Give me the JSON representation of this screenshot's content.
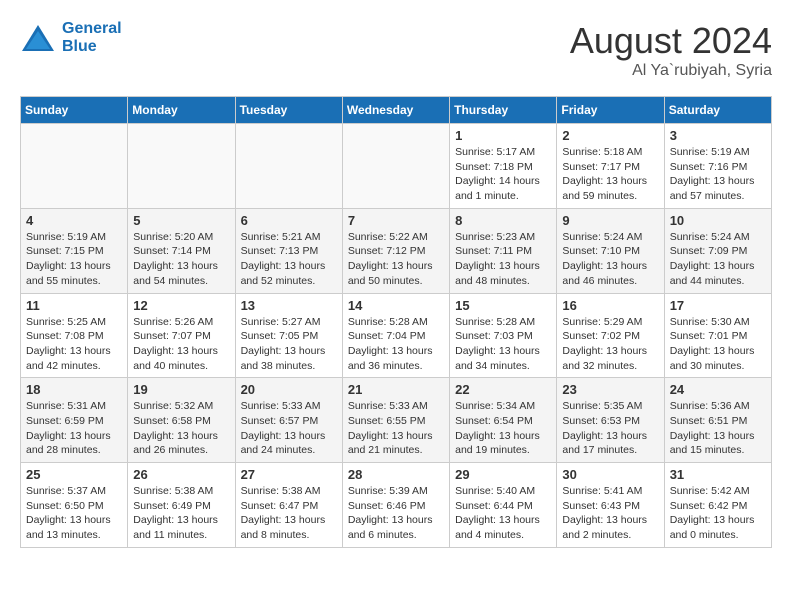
{
  "header": {
    "logo_line1": "General",
    "logo_line2": "Blue",
    "month": "August 2024",
    "location": "Al Ya`rubiyah, Syria"
  },
  "weekdays": [
    "Sunday",
    "Monday",
    "Tuesday",
    "Wednesday",
    "Thursday",
    "Friday",
    "Saturday"
  ],
  "weeks": [
    [
      {
        "day": "",
        "info": ""
      },
      {
        "day": "",
        "info": ""
      },
      {
        "day": "",
        "info": ""
      },
      {
        "day": "",
        "info": ""
      },
      {
        "day": "1",
        "info": "Sunrise: 5:17 AM\nSunset: 7:18 PM\nDaylight: 14 hours\nand 1 minute."
      },
      {
        "day": "2",
        "info": "Sunrise: 5:18 AM\nSunset: 7:17 PM\nDaylight: 13 hours\nand 59 minutes."
      },
      {
        "day": "3",
        "info": "Sunrise: 5:19 AM\nSunset: 7:16 PM\nDaylight: 13 hours\nand 57 minutes."
      }
    ],
    [
      {
        "day": "4",
        "info": "Sunrise: 5:19 AM\nSunset: 7:15 PM\nDaylight: 13 hours\nand 55 minutes."
      },
      {
        "day": "5",
        "info": "Sunrise: 5:20 AM\nSunset: 7:14 PM\nDaylight: 13 hours\nand 54 minutes."
      },
      {
        "day": "6",
        "info": "Sunrise: 5:21 AM\nSunset: 7:13 PM\nDaylight: 13 hours\nand 52 minutes."
      },
      {
        "day": "7",
        "info": "Sunrise: 5:22 AM\nSunset: 7:12 PM\nDaylight: 13 hours\nand 50 minutes."
      },
      {
        "day": "8",
        "info": "Sunrise: 5:23 AM\nSunset: 7:11 PM\nDaylight: 13 hours\nand 48 minutes."
      },
      {
        "day": "9",
        "info": "Sunrise: 5:24 AM\nSunset: 7:10 PM\nDaylight: 13 hours\nand 46 minutes."
      },
      {
        "day": "10",
        "info": "Sunrise: 5:24 AM\nSunset: 7:09 PM\nDaylight: 13 hours\nand 44 minutes."
      }
    ],
    [
      {
        "day": "11",
        "info": "Sunrise: 5:25 AM\nSunset: 7:08 PM\nDaylight: 13 hours\nand 42 minutes."
      },
      {
        "day": "12",
        "info": "Sunrise: 5:26 AM\nSunset: 7:07 PM\nDaylight: 13 hours\nand 40 minutes."
      },
      {
        "day": "13",
        "info": "Sunrise: 5:27 AM\nSunset: 7:05 PM\nDaylight: 13 hours\nand 38 minutes."
      },
      {
        "day": "14",
        "info": "Sunrise: 5:28 AM\nSunset: 7:04 PM\nDaylight: 13 hours\nand 36 minutes."
      },
      {
        "day": "15",
        "info": "Sunrise: 5:28 AM\nSunset: 7:03 PM\nDaylight: 13 hours\nand 34 minutes."
      },
      {
        "day": "16",
        "info": "Sunrise: 5:29 AM\nSunset: 7:02 PM\nDaylight: 13 hours\nand 32 minutes."
      },
      {
        "day": "17",
        "info": "Sunrise: 5:30 AM\nSunset: 7:01 PM\nDaylight: 13 hours\nand 30 minutes."
      }
    ],
    [
      {
        "day": "18",
        "info": "Sunrise: 5:31 AM\nSunset: 6:59 PM\nDaylight: 13 hours\nand 28 minutes."
      },
      {
        "day": "19",
        "info": "Sunrise: 5:32 AM\nSunset: 6:58 PM\nDaylight: 13 hours\nand 26 minutes."
      },
      {
        "day": "20",
        "info": "Sunrise: 5:33 AM\nSunset: 6:57 PM\nDaylight: 13 hours\nand 24 minutes."
      },
      {
        "day": "21",
        "info": "Sunrise: 5:33 AM\nSunset: 6:55 PM\nDaylight: 13 hours\nand 21 minutes."
      },
      {
        "day": "22",
        "info": "Sunrise: 5:34 AM\nSunset: 6:54 PM\nDaylight: 13 hours\nand 19 minutes."
      },
      {
        "day": "23",
        "info": "Sunrise: 5:35 AM\nSunset: 6:53 PM\nDaylight: 13 hours\nand 17 minutes."
      },
      {
        "day": "24",
        "info": "Sunrise: 5:36 AM\nSunset: 6:51 PM\nDaylight: 13 hours\nand 15 minutes."
      }
    ],
    [
      {
        "day": "25",
        "info": "Sunrise: 5:37 AM\nSunset: 6:50 PM\nDaylight: 13 hours\nand 13 minutes."
      },
      {
        "day": "26",
        "info": "Sunrise: 5:38 AM\nSunset: 6:49 PM\nDaylight: 13 hours\nand 11 minutes."
      },
      {
        "day": "27",
        "info": "Sunrise: 5:38 AM\nSunset: 6:47 PM\nDaylight: 13 hours\nand 8 minutes."
      },
      {
        "day": "28",
        "info": "Sunrise: 5:39 AM\nSunset: 6:46 PM\nDaylight: 13 hours\nand 6 minutes."
      },
      {
        "day": "29",
        "info": "Sunrise: 5:40 AM\nSunset: 6:44 PM\nDaylight: 13 hours\nand 4 minutes."
      },
      {
        "day": "30",
        "info": "Sunrise: 5:41 AM\nSunset: 6:43 PM\nDaylight: 13 hours\nand 2 minutes."
      },
      {
        "day": "31",
        "info": "Sunrise: 5:42 AM\nSunset: 6:42 PM\nDaylight: 13 hours\nand 0 minutes."
      }
    ]
  ]
}
